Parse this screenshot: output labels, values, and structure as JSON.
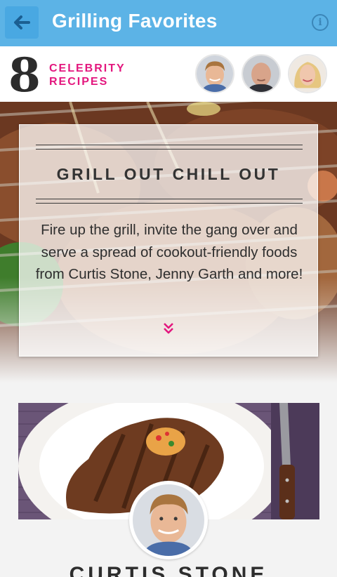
{
  "header": {
    "title": "Grilling Favorites",
    "back_icon": "arrow-left-icon",
    "info_icon": "info-icon",
    "info_glyph": "i",
    "bg_color": "#5cb3e6",
    "accent_color": "#e3177e"
  },
  "summary": {
    "count": "8",
    "line1": "CELEBRITY",
    "line2": "RECIPES"
  },
  "intro": {
    "heading": "GRILL OUT CHILL OUT",
    "body": "Fire up the grill, invite the gang over and serve a spread of cookout-friendly foods from Curtis Stone, Jenny Garth and more!",
    "more_icon": "double-chevron-down-icon"
  },
  "recipe": {
    "chef_name": "CURTIS STONE"
  }
}
